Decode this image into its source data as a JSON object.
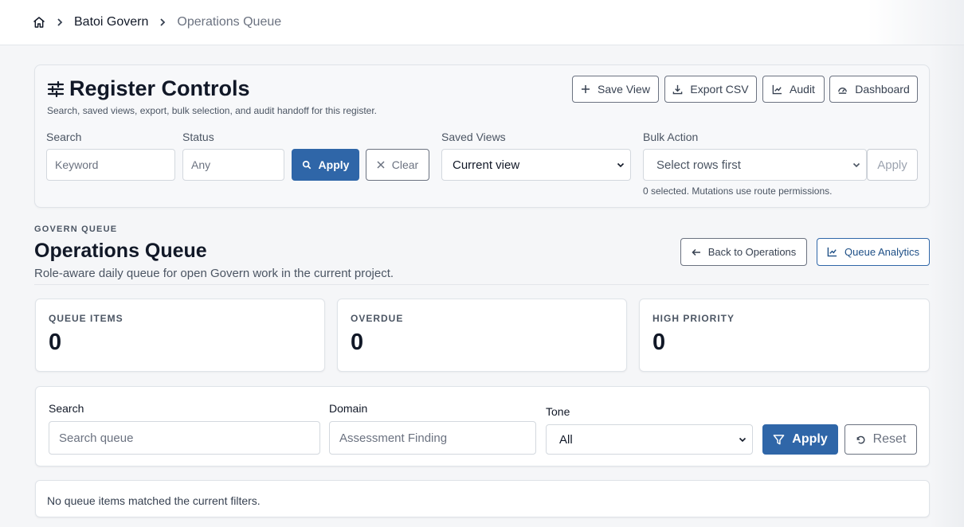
{
  "breadcrumb": {
    "home_icon": "home-icon",
    "items": [
      "Batoi Govern",
      "Operations Queue"
    ]
  },
  "register_controls": {
    "title": "Register Controls",
    "subtitle": "Search, saved views, export, bulk selection, and audit handoff for this register.",
    "actions": {
      "save_view": "Save View",
      "export_csv": "Export CSV",
      "audit": "Audit",
      "dashboard": "Dashboard"
    },
    "search": {
      "label": "Search",
      "placeholder": "Keyword"
    },
    "status": {
      "label": "Status",
      "placeholder": "Any"
    },
    "apply_label": "Apply",
    "clear_label": "Clear",
    "saved_views": {
      "label": "Saved Views",
      "value": "Current view"
    },
    "bulk_action": {
      "label": "Bulk Action",
      "value": "Select rows first",
      "apply_label": "Apply",
      "hint": "0 selected. Mutations use route permissions."
    }
  },
  "page": {
    "eyebrow": "GOVERN QUEUE",
    "title": "Operations Queue",
    "description": "Role-aware daily queue for open Govern work in the current project.",
    "back_label": "Back to Operations",
    "analytics_label": "Queue Analytics"
  },
  "stats": [
    {
      "label": "QUEUE ITEMS",
      "value": "0"
    },
    {
      "label": "OVERDUE",
      "value": "0"
    },
    {
      "label": "HIGH PRIORITY",
      "value": "0"
    }
  ],
  "filters": {
    "search": {
      "label": "Search",
      "placeholder": "Search queue"
    },
    "domain": {
      "label": "Domain",
      "placeholder": "Assessment Finding"
    },
    "tone": {
      "label": "Tone",
      "value": "All"
    },
    "apply_label": "Apply",
    "reset_label": "Reset"
  },
  "empty_message": "No queue items matched the current filters.",
  "colors": {
    "primary": "#2f66a8",
    "border": "#dfe3e8",
    "background": "#f5f6f8"
  }
}
